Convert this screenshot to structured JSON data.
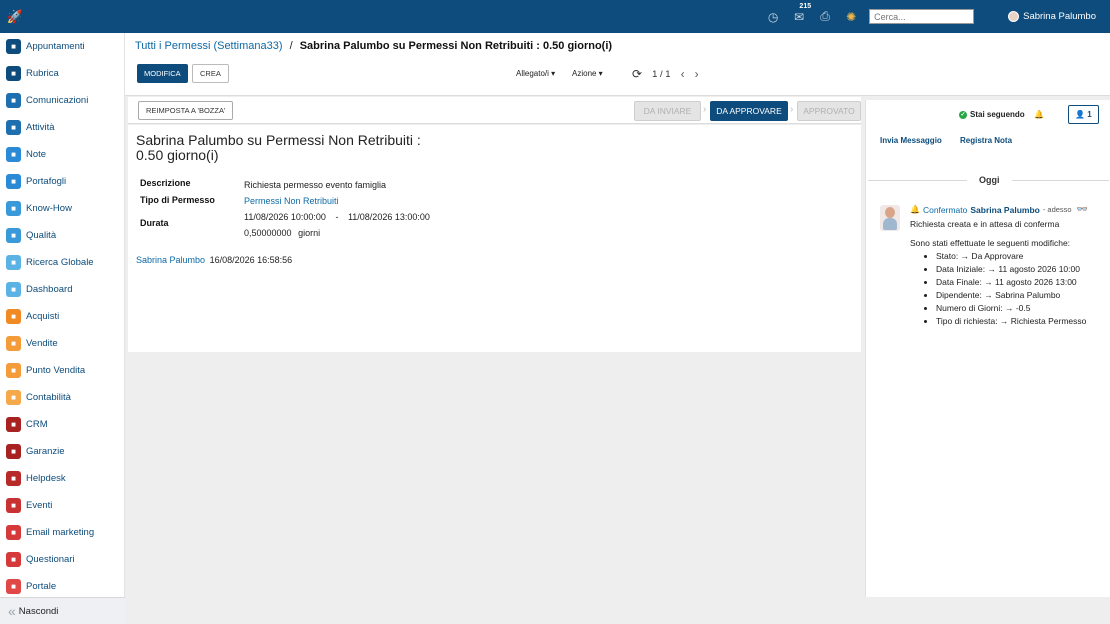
{
  "topbar": {
    "icons": [
      "rocket-icon",
      "clock-icon",
      "chat-icon",
      "print-icon",
      "bug-icon"
    ],
    "chat_badge": "215",
    "search_placeholder": "Cerca...",
    "user_name": "Sabrina Palumbo"
  },
  "sidebar": {
    "items": [
      {
        "label": "Appuntamenti",
        "icon": "calendar-icon",
        "color": "#0d4c7c"
      },
      {
        "label": "Rubrica",
        "icon": "contacts-icon",
        "color": "#0d4c7c"
      },
      {
        "label": "Comunicazioni",
        "icon": "speech-icon",
        "color": "#1e6fb0"
      },
      {
        "label": "Attività",
        "icon": "checklist-icon",
        "color": "#1e6fb0"
      },
      {
        "label": "Note",
        "icon": "note-icon",
        "color": "#2b8ad6"
      },
      {
        "label": "Portafogli",
        "icon": "lock-icon",
        "color": "#2b8ad6"
      },
      {
        "label": "Know-How",
        "icon": "brain-icon",
        "color": "#3a9ad9"
      },
      {
        "label": "Qualità",
        "icon": "quality-icon",
        "color": "#3a9ad9"
      },
      {
        "label": "Ricerca Globale",
        "icon": "search-icon",
        "color": "#5bb3e5"
      },
      {
        "label": "Dashboard",
        "icon": "gauge-icon",
        "color": "#5bb3e5"
      },
      {
        "label": "Acquisti",
        "icon": "card-icon",
        "color": "#f08a24"
      },
      {
        "label": "Vendite",
        "icon": "chart-icon",
        "color": "#f59c3a"
      },
      {
        "label": "Punto Vendita",
        "icon": "register-icon",
        "color": "#f59c3a"
      },
      {
        "label": "Contabilità",
        "icon": "ledger-icon",
        "color": "#f6a94b"
      },
      {
        "label": "CRM",
        "icon": "handshake-icon",
        "color": "#a82222"
      },
      {
        "label": "Garanzie",
        "icon": "shield-icon",
        "color": "#a82222"
      },
      {
        "label": "Helpdesk",
        "icon": "headset-icon",
        "color": "#b82a2a"
      },
      {
        "label": "Eventi",
        "icon": "ticket-icon",
        "color": "#c93232"
      },
      {
        "label": "Email marketing",
        "icon": "paperplane-icon",
        "color": "#d63939"
      },
      {
        "label": "Questionari",
        "icon": "survey-icon",
        "color": "#d63939"
      },
      {
        "label": "Portale",
        "icon": "portal-icon",
        "color": "#e04747"
      }
    ],
    "hide_label": "Nascondi"
  },
  "control_panel": {
    "breadcrumb_link": "Tutti i Permessi (Settimana33)",
    "breadcrumb_sep": "/",
    "breadcrumb_current": "Sabrina Palumbo su Permessi Non Retribuiti : 0.50 giorno(i)",
    "edit_label": "MODIFICA",
    "create_label": "CREA",
    "attachments_label": "Allegato/i ▾",
    "action_label": "Azione ▾",
    "pager": "1 / 1"
  },
  "status_bar": {
    "reset_label": "REIMPOSTA A 'BOZZA'",
    "stages": [
      "DA INVIARE",
      "DA APPROVARE",
      "APPROVATO"
    ],
    "active_stage": "DA APPROVARE"
  },
  "record": {
    "title": "Sabrina Palumbo su Permessi Non Retribuiti : 0.50 giorno(i)",
    "description_label": "Descrizione",
    "description_value": "Richiesta permesso evento famiglia",
    "type_label": "Tipo di Permesso",
    "type_value": "Permessi Non Retribuiti",
    "duration_label": "Durata",
    "date_from": "11/08/2026 10:00:00",
    "date_sep": "-",
    "date_to": "11/08/2026 13:00:00",
    "days_value": "0,50000000",
    "days_unit": "giorni",
    "creator": "Sabrina Palumbo",
    "created_at": "16/08/2026 16:58:56"
  },
  "chatter": {
    "following_label": "Stai seguendo",
    "followers_count": "1",
    "send_message_label": "Invia Messaggio",
    "log_note_label": "Registra Nota",
    "day_label": "Oggi",
    "message": {
      "status_label": "Confermato",
      "author": "Sabrina Palumbo",
      "time": "- adesso",
      "body": "Richiesta creata e in attesa di conferma",
      "changes_intro": "Sono stati effettuate le seguenti modifiche:",
      "changes": [
        "Stato: → Da Approvare",
        "Data Iniziale: → 11 agosto 2026 10:00",
        "Data Finale: → 11 agosto 2026 13:00",
        "Dipendente: → Sabrina Palumbo",
        "Numero di Giorni: → -0.5",
        "Tipo di richiesta: → Richiesta Permesso"
      ]
    }
  }
}
